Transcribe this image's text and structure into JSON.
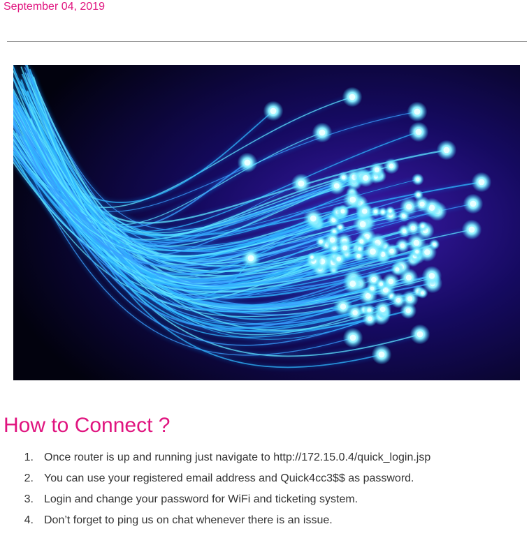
{
  "post": {
    "date": "September 04, 2019",
    "hero_image": {
      "subject": "glowing blue fiber optic cables",
      "colors": {
        "glow": "#2fd3ff",
        "deep": "#1a40ff",
        "background": "#05052a"
      }
    }
  },
  "article": {
    "heading": "How to Connect ?",
    "accent_color": "#e0147f",
    "steps": [
      {
        "num": "1.",
        "text": "Once router is up and running just navigate to http://172.15.0.4/quick_login.jsp"
      },
      {
        "num": "2.",
        "text": "You can use your registered email address and Quick4cc3$$ as password."
      },
      {
        "num": "3.",
        "text": "Login and change your password for WiFi and ticketing system."
      },
      {
        "num": "4.",
        "text": "Don’t forget to ping us on chat whenever there is an issue."
      }
    ]
  }
}
